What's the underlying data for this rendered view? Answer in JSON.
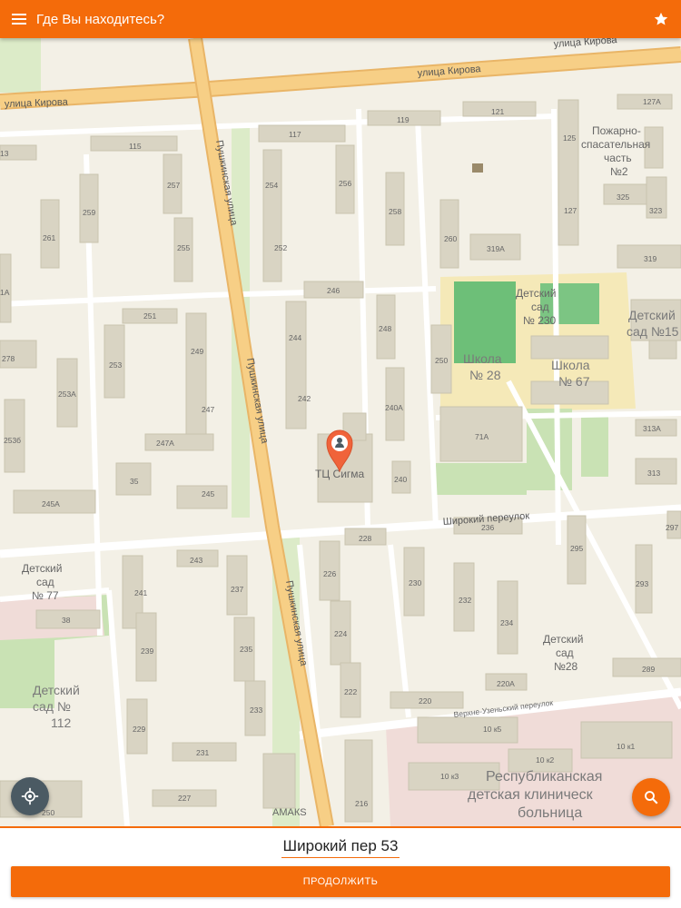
{
  "header": {
    "title": "Где Вы находитесь?",
    "menu_icon": "menu-icon",
    "favorite_icon": "star-icon"
  },
  "map": {
    "streets": {
      "kirova_top": "улица Кирова",
      "kirova_mid": "улица Кирова",
      "kirova_left": "улица Кирова",
      "pushkinskaya_top": "Пушкинская улица",
      "pushkinskaya_mid": "Пушкинская улица",
      "pushkinskaya_bottom": "Пушкинская улица",
      "shirokiy": "Широкий переулок",
      "verkhne_uzenskiy": "Верхне-Узеньский переулок"
    },
    "pois": {
      "fire_station": [
        "Пожарно-",
        "спасательная",
        "часть",
        "№2"
      ],
      "kindergarten_230": [
        "Детский",
        "сад",
        "№ 230"
      ],
      "kindergarten_15": [
        "Детский",
        "сад №15"
      ],
      "school_28": [
        "Школа",
        "№ 28"
      ],
      "school_67": [
        "Школа",
        "№ 67"
      ],
      "mall": "ТЦ Сигма",
      "kindergarten_77": [
        "Детский",
        "сад",
        "№ 77"
      ],
      "kindergarten_28": [
        "Детский",
        "сад",
        "№28"
      ],
      "kindergarten_112": [
        "Детский",
        "сад №",
        "112"
      ],
      "hospital": [
        "Республиканская",
        "детская клиническ",
        "больница"
      ],
      "amaks": "АМАКS"
    },
    "building_numbers": {
      "b127A": "127А",
      "b119": "119",
      "b121": "121",
      "b117": "117",
      "b115": "115",
      "b125": "125",
      "b13": "13",
      "b257": "257",
      "b254": "254",
      "b256": "256",
      "b258": "258",
      "b260": "260",
      "b319A": "319А",
      "b325": "325",
      "b323": "323",
      "b127": "127",
      "b259": "259",
      "b261": "261",
      "b255": "255",
      "b252": "252",
      "b319": "319",
      "b246": "246",
      "b251": "251",
      "b1A": "1А",
      "b248": "248",
      "b244": "244",
      "b249": "249",
      "b278": "278",
      "b253": "253",
      "b250": "250",
      "b253A": "253А",
      "b242": "242",
      "b240A": "240А",
      "b247": "247",
      "b253b": "253б",
      "b313A": "313А",
      "b71A": "71А",
      "b247A": "247А",
      "b35": "35",
      "b245": "245",
      "b240": "240",
      "b313": "313",
      "b245A": "245А",
      "b236": "236",
      "b228": "228",
      "b297": "297",
      "b243": "243",
      "b295": "295",
      "b226": "226",
      "b230": "230",
      "b237": "237",
      "b241": "241",
      "b293": "293",
      "b232": "232",
      "b234": "234",
      "b38": "38",
      "b224": "224",
      "b235": "235",
      "b239": "239",
      "b222": "222",
      "b220A": "220А",
      "b289": "289",
      "b233": "233",
      "b220": "220",
      "b229": "229",
      "b10k5": "10 к5",
      "b231": "231",
      "b10k1": "10 к1",
      "b10k2": "10 к2",
      "b10k3": "10 к3",
      "b227": "227",
      "b216": "216",
      "b250b": "250"
    }
  },
  "actions": {
    "locate_icon": "crosshair-location-icon",
    "search_icon": "search-icon"
  },
  "footer": {
    "address": "Широкий пер 53",
    "continue_label": "ПРОДОЛЖИТЬ"
  },
  "colors": {
    "accent": "#f46b0a",
    "locate_button": "#4b5a63",
    "main_road": "#f5c77a",
    "building": "#d9d4c3",
    "park": "#c9e2b4",
    "stadium": "#6dbf78",
    "hospital": "#f0dcd8"
  }
}
